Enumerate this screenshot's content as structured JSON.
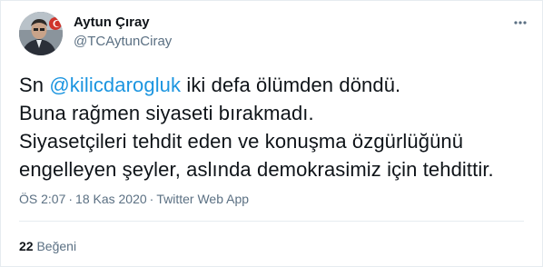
{
  "author": {
    "display_name": "Aytun Çıray",
    "handle": "@TCAytunCiray",
    "avatar": "avatar-photo"
  },
  "tweet": {
    "line1_prefix": "Sn ",
    "mention": "@kilicdarogluk",
    "line1_suffix": " iki defa ölümden döndü.",
    "line2": "Buna rağmen siyaseti bırakmadı.",
    "line3": "Siyasetçileri tehdit eden ve konuşma özgürlüğünü",
    "line4": "engelleyen şeyler, aslında demokrasimiz için tehdittir."
  },
  "meta": {
    "time": "ÖS 2:07",
    "separator": "·",
    "date": "18 Kas 2020",
    "source": "Twitter Web App"
  },
  "stats": {
    "likes_count": "22",
    "likes_label": "Beğeni"
  },
  "icons": {
    "more": "more-options-icon"
  },
  "colors": {
    "mention": "#1b95e0",
    "secondary_text": "#5b7083",
    "primary_text": "#0f1419",
    "border": "#e6ecf0"
  }
}
